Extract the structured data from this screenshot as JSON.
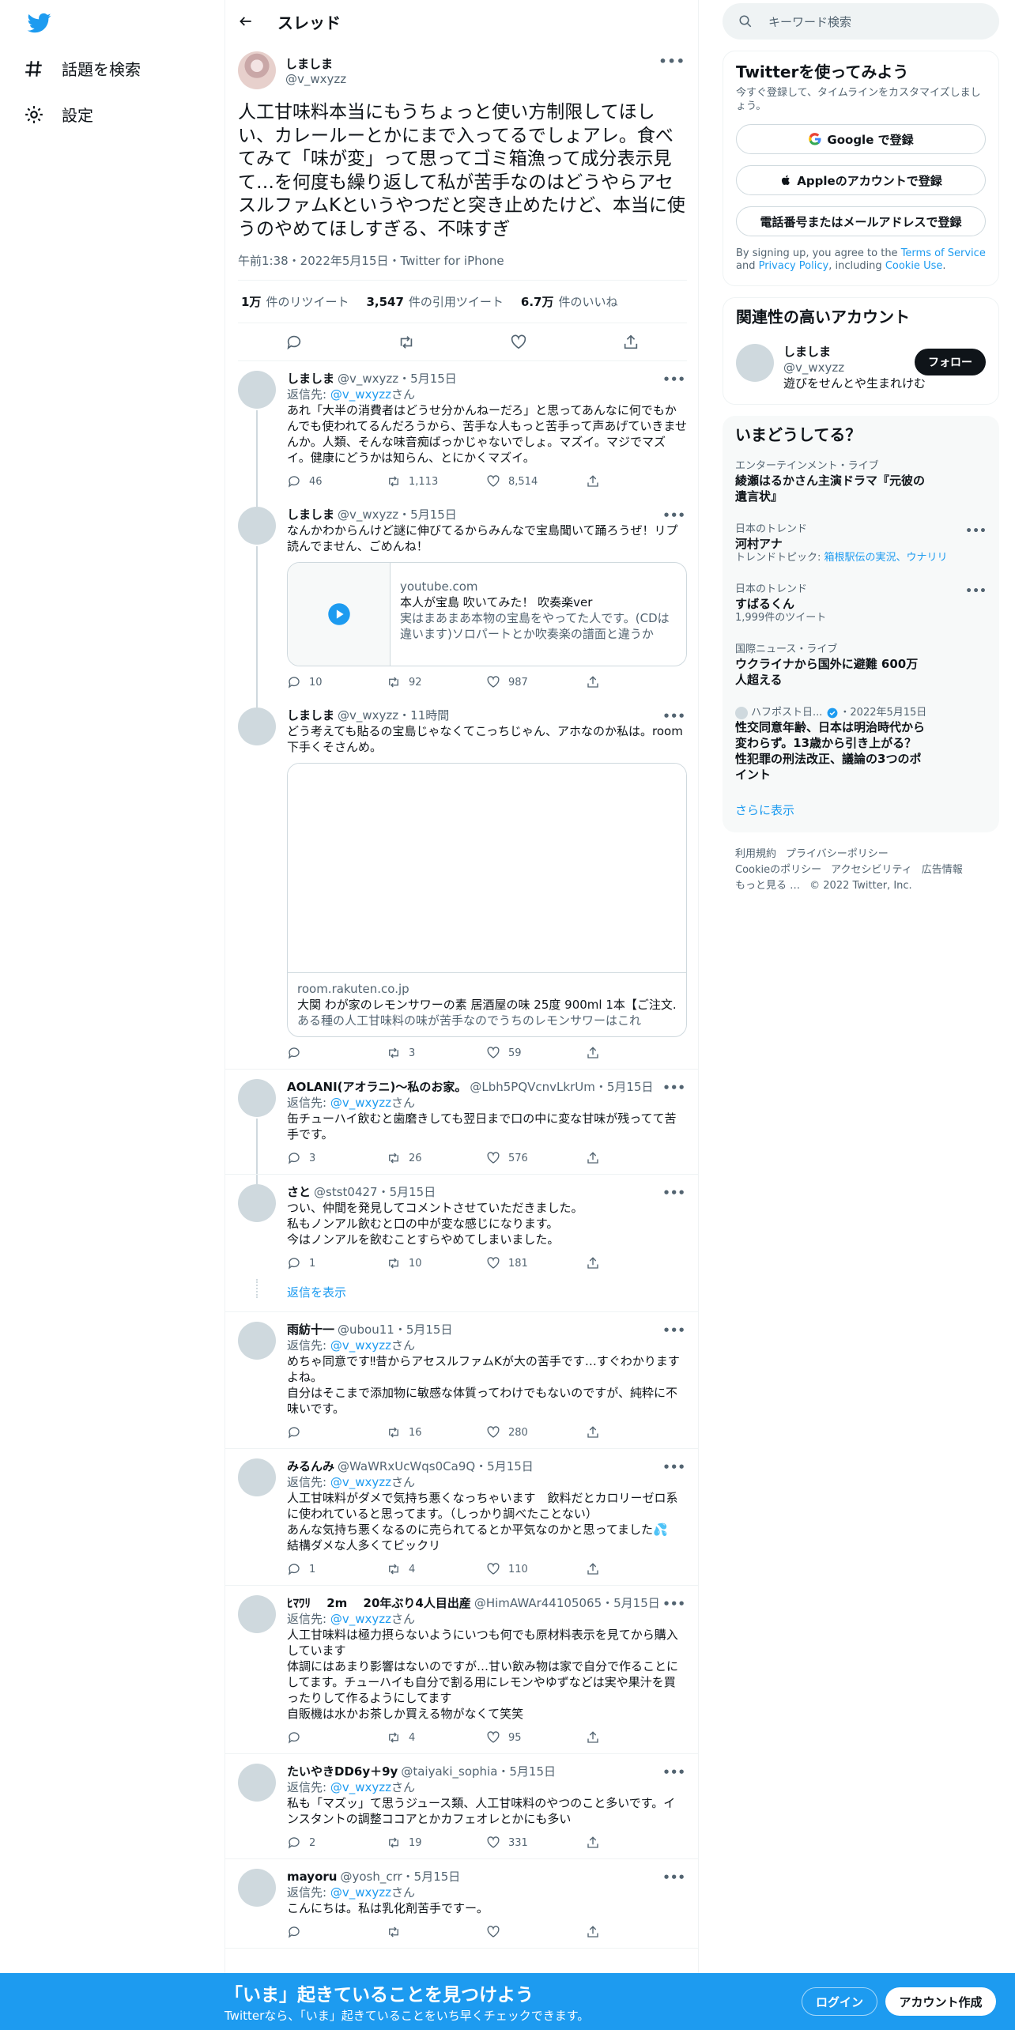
{
  "nav": {
    "explore": "話題を検索",
    "settings": "設定"
  },
  "header": {
    "title": "スレッド"
  },
  "focus": {
    "name": "しましま",
    "handle": "@v_wxyzz",
    "text": "人工甘味料本当にもうちょっと使い方制限してほしい、カレールーとかにまで入ってるでしょアレ。食べてみて「味が変」って思ってゴミ箱漁って成分表示見て…を何度も繰り返して私が苦手なのはどうやらアセスルファムKというやつだと突き止めたけど、本当に使うのやめてほしすぎる、不味すぎ",
    "meta": "午前1:38・2022年5月15日・Twitter for iPhone",
    "retweets": "1万",
    "retweets_label": "件のリツイート",
    "quotes": "3,547",
    "quotes_label": "件の引用ツイート",
    "likes": "6.7万",
    "likes_label": "件のいいね"
  },
  "replies": [
    {
      "name": "しましま",
      "handle": "@v_wxyzz",
      "date": "・5月15日",
      "to_prefix": "返信先: ",
      "to": "@v_wxyzz",
      "to_suffix": "さん",
      "text": "あれ「大半の消費者はどうせ分かんねーだろ」と思ってあんなに何でもかんでも使われてるんだろうから、苦手な人もっと苦手って声あげていきませんか。人類、そんな味音痴ばっかじゃないでしょ。マズイ。マジでマズイ。健康にどうかは知らん、とにかくマズイ。",
      "reply": "46",
      "rt": "1,113",
      "like": "8,514"
    },
    {
      "name": "しましま",
      "handle": "@v_wxyzz",
      "date": "・5月15日",
      "text": "なんかわからんけど謎に伸びてるからみんなで宝島聞いて踊ろうぜ！リプ読んでません、ごめんね！",
      "card": {
        "domain": "youtube.com",
        "title": "本人が宝島 吹いてみた！ 吹奏楽ver",
        "desc": "実はまあまあ本物の宝島をやってた人です。(CDは違います)ソロパートとか吹奏楽の譜面と違うから..."
      },
      "reply": "10",
      "rt": "92",
      "like": "987"
    },
    {
      "name": "しましま",
      "handle": "@v_wxyzz",
      "date": "・11時間",
      "text": "どう考えても貼るの宝島じゃなくてこっちじゃん、アホなのか私は。room下手くそさんめ。",
      "card": {
        "domain": "room.rakuten.co.jp",
        "title": "大関 わが家のレモンサワーの素 居酒屋の味 25度 900ml 1本【ご注文...",
        "desc": "ある種の人工甘味料の味が苦手なのでうちのレモンサワーはこれ"
      },
      "reply": "",
      "rt": "3",
      "like": "59"
    },
    {
      "name": "AOLANI(アオラニ)〜私のお家。",
      "handle": "@Lbh5PQVcnvLkrUm",
      "date": "・5月15日",
      "to_prefix": "返信先: ",
      "to": "@v_wxyzz",
      "to_suffix": "さん",
      "text": "缶チューハイ飲むと歯磨きしても翌日まで口の中に変な甘味が残ってて苦手です。",
      "reply": "3",
      "rt": "26",
      "like": "576"
    },
    {
      "name": "さと",
      "handle": "@stst0427",
      "date": "・5月15日",
      "text": "つい、仲間を発見してコメントさせていただきました。\n私もノンアル飲むと口の中が変な感じになります。\n今はノンアルを飲むことすらやめてしまいました。",
      "reply": "1",
      "rt": "10",
      "like": "181"
    },
    {
      "name": "雨紡十一",
      "handle": "@ubou11",
      "date": "・5月15日",
      "to_prefix": "返信先: ",
      "to": "@v_wxyzz",
      "to_suffix": "さん",
      "text": "めちゃ同意です‼︎昔からアセスルファムKが大の苦手です…すぐわかりますよね。\n自分はそこまで添加物に敏感な体質ってわけでもないのですが、純粋に不味いです。",
      "reply": "",
      "rt": "16",
      "like": "280"
    },
    {
      "name": "みるんみ",
      "handle": "@WaWRxUcWqs0Ca9Q",
      "date": "・5月15日",
      "to_prefix": "返信先: ",
      "to": "@v_wxyzz",
      "to_suffix": "さん",
      "text": "人工甘味料がダメで気持ち悪くなっちゃいます　飲料だとカロリーゼロ系に使われていると思ってます。（しっかり調べたことない）\nあんな気持ち悪くなるのに売られてるとか平気なのかと思ってました💦\n結構ダメな人多くてビックリ",
      "reply": "1",
      "rt": "4",
      "like": "110"
    },
    {
      "name": "ﾋﾏﾜﾘ　 2m　 20年ぶり4人目出産",
      "handle": "@HimAWAr44105065",
      "date": "・5月15日",
      "to_prefix": "返信先: ",
      "to": "@v_wxyzz",
      "to_suffix": "さん",
      "text": "人工甘味料は極力摂らないようにいつも何でも原材料表示を見てから購入しています\n体調にはあまり影響はないのですが…甘い飲み物は家で自分で作ることにしてます。チューハイも自分で割る用にレモンやゆずなどは実や果汁を買ったりして作るようにしてます\n自販機は水かお茶しか買える物がなくて笑笑",
      "reply": "",
      "rt": "4",
      "like": "95"
    },
    {
      "name": "たいやきDD6y＋9y",
      "handle": "@taiyaki_sophia",
      "date": "・5月15日",
      "to_prefix": "返信先: ",
      "to": "@v_wxyzz",
      "to_suffix": "さん",
      "text": "私も「マズッ」て思うジュース類、人工甘味料のやつのこと多いです。インスタントの調整ココアとかカフェオレとかにも多い",
      "reply": "2",
      "rt": "19",
      "like": "331"
    },
    {
      "name": "mayoru",
      "handle": "@yosh_crr",
      "date": "・5月15日",
      "to_prefix": "返信先: ",
      "to": "@v_wxyzz",
      "to_suffix": "さん",
      "text": "こんにちは。私は乳化剤苦手ですー。",
      "reply": "",
      "rt": "",
      "like": ""
    }
  ],
  "show_replies": "返信を表示",
  "sidebar": {
    "search_placeholder": "キーワード検索",
    "signup": {
      "title": "Twitterを使ってみよう",
      "sub": "今すぐ登録して、タイムラインをカスタマイズしましょう。",
      "google": "Google で登録",
      "apple": "Appleのアカウントで登録",
      "phone": "電話番号またはメールアドレスで登録",
      "legal1": "By signing up, you agree to the ",
      "tos": "Terms of Service",
      "legal2": " and ",
      "privacy": "Privacy Policy",
      "legal3": ", including ",
      "cookie": "Cookie Use",
      "legal4": "."
    },
    "related": {
      "title": "関連性の高いアカウント",
      "name": "しましま",
      "handle": "@v_wxyzz",
      "bio": "遊びをせんとや生まれけむ",
      "follow": "フォロー"
    },
    "trends": {
      "title": "いまどうしてる？",
      "items": [
        {
          "cat": "エンターテインメント・ライブ",
          "head": "綾瀬はるかさん主演ドラマ『元彼の遺言状』",
          "sub": ""
        },
        {
          "cat": "日本のトレンド",
          "head": "河村アナ",
          "sub_prefix": "トレンドトピック: ",
          "sub": "箱根駅伝の実況、ウナリリ"
        },
        {
          "cat": "日本のトレンド",
          "head": "すばるくん",
          "sub": "1,999件のツイート"
        },
        {
          "cat": "国際ニュース・ライブ",
          "head": "ウクライナから国外に避難 600万人超える",
          "sub": ""
        },
        {
          "cat": "ハフポスト日...",
          "date": "・2022年5月15日",
          "head": "性交同意年齢、日本は明治時代から変わらず。13歳から引き上がる？性犯罪の刑法改正、議論の3つのポイント",
          "sub": ""
        }
      ],
      "more": "さらに表示"
    },
    "footer": {
      "terms": "利用規約",
      "privacy": "プライバシーポリシー",
      "cookie": "Cookieのポリシー",
      "access": "アクセシビリティ",
      "ads": "広告情報",
      "more": "もっと見る …",
      "copy": "© 2022 Twitter, Inc."
    }
  },
  "banner": {
    "title": "「いま」起きていることを見つけよう",
    "sub": "Twitterなら、「いま」起きていることをいち早くチェックできます。",
    "login": "ログイン",
    "signup": "アカウント作成"
  },
  "colors": {
    "brand": "#1d9bf0",
    "text": "#0f1419",
    "muted": "#536471"
  }
}
